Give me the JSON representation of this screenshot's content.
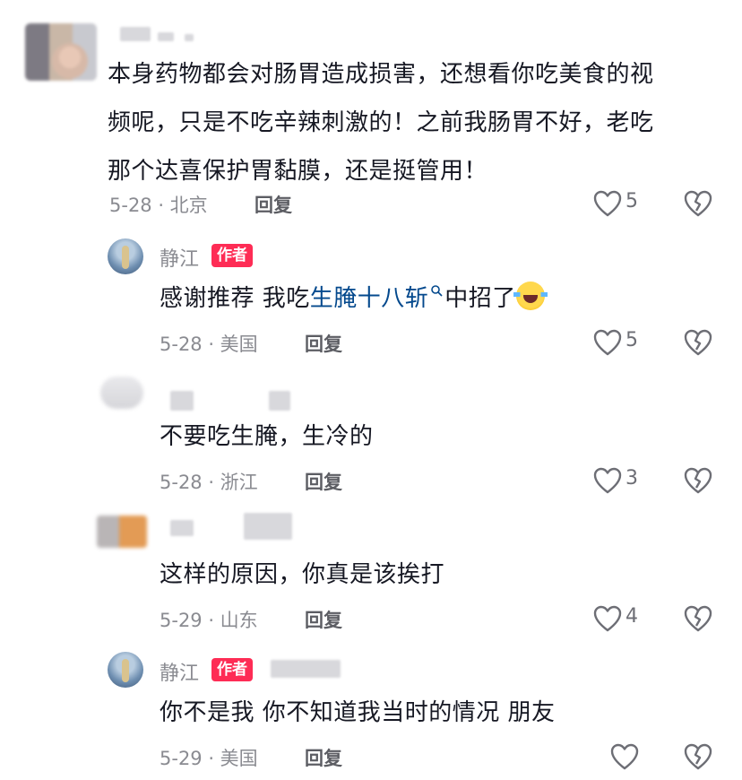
{
  "comments": [
    {
      "text": "本身药物都会对肠胃造成损害，还想看你吃美食的视频呢，只是不吃辛辣刺激的！之前我肠胃不好，老吃那个达喜保护胃黏膜，还是挺管用！",
      "lines": [
        "本身药物都会对肠胃造成损害，还想看你吃美食的视",
        "频呢，只是不吃辛辣刺激的！之前我肠胃不好，老吃",
        "那个达喜保护胃黏膜，还是挺管用！"
      ],
      "date_location": "5-28 · 北京",
      "reply_label": "回复",
      "likes": "5",
      "replies": [
        {
          "author": "静江",
          "badge": "作者",
          "text_before": "感谢推荐 我吃",
          "link_text": "生腌十八斩",
          "text_after": "中招了",
          "emoji": "rolling-laughing-emoji",
          "date_location": "5-28 · 美国",
          "reply_label": "回复",
          "likes": "5"
        },
        {
          "text": "不要吃生腌，生冷的",
          "date_location": "5-28 · 浙江",
          "reply_label": "回复",
          "likes": "3"
        },
        {
          "text": "这样的原因，你真是该挨打",
          "date_location": "5-29 · 山东",
          "reply_label": "回复",
          "likes": "4"
        },
        {
          "author": "静江",
          "badge": "作者",
          "text": "你不是我 你不知道我当时的情况 朋友",
          "date_location": "5-29 · 美国",
          "reply_label": "回复",
          "likes": ""
        }
      ]
    }
  ],
  "icons": {
    "like": "heart-outline-icon",
    "dislike": "broken-heart-icon",
    "link_search": "search-icon"
  },
  "colors": {
    "author_badge": "#fe2c55",
    "link": "#04498d",
    "meta": "#8a8b91"
  }
}
